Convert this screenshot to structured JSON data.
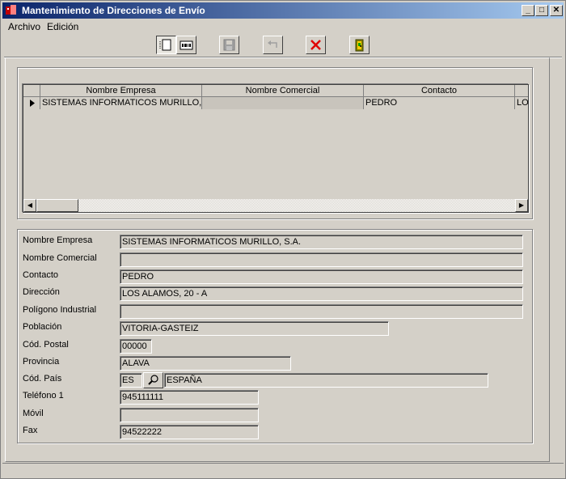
{
  "window": {
    "title": "Mantenimiento de Direcciones de Envío"
  },
  "menu": [
    "Archivo",
    "Edición"
  ],
  "toolbar": {
    "buttons": [
      {
        "name": "new-record-button",
        "icon": "document-icon"
      },
      {
        "name": "edit-record-button",
        "icon": "edit-icon"
      },
      {
        "name": "save-button",
        "icon": "floppy-disk-icon"
      },
      {
        "name": "undo-button",
        "icon": "undo-arrow-icon"
      },
      {
        "name": "delete-button",
        "icon": "red-x-icon"
      },
      {
        "name": "exit-button",
        "icon": "door-exit-icon"
      }
    ]
  },
  "grid": {
    "columns": [
      "Nombre Empresa",
      "Nombre  Comercial",
      "Contacto"
    ],
    "rows": [
      {
        "nombre_empresa": "SISTEMAS INFORMATICOS MURILLO, S",
        "nombre_comercial": "",
        "contacto": "PEDRO",
        "extra": "LO"
      }
    ]
  },
  "form": {
    "nombre_empresa": {
      "label": "Nombre Empresa",
      "value": "SISTEMAS INFORMATICOS MURILLO, S.A."
    },
    "nombre_comercial": {
      "label": "Nombre Comercial",
      "value": ""
    },
    "contacto": {
      "label": "Contacto",
      "value": "PEDRO"
    },
    "direccion": {
      "label": "Dirección",
      "value": "LOS ALAMOS, 20 - A"
    },
    "poligono": {
      "label": "Polígono Industrial",
      "value": ""
    },
    "poblacion": {
      "label": "Población",
      "value": "VITORIA-GASTEIZ"
    },
    "cod_postal": {
      "label": "Cód. Postal",
      "value": "00000"
    },
    "provincia": {
      "label": "Provincia",
      "value": "ALAVA"
    },
    "cod_pais": {
      "label": "Cód. País",
      "value": "ES",
      "name_value": "ESPAÑA"
    },
    "telefono1": {
      "label": "Teléfono 1",
      "value": "945111111"
    },
    "movil": {
      "label": "Móvil",
      "value": ""
    },
    "fax": {
      "label": "Fax",
      "value": "94522222"
    }
  }
}
